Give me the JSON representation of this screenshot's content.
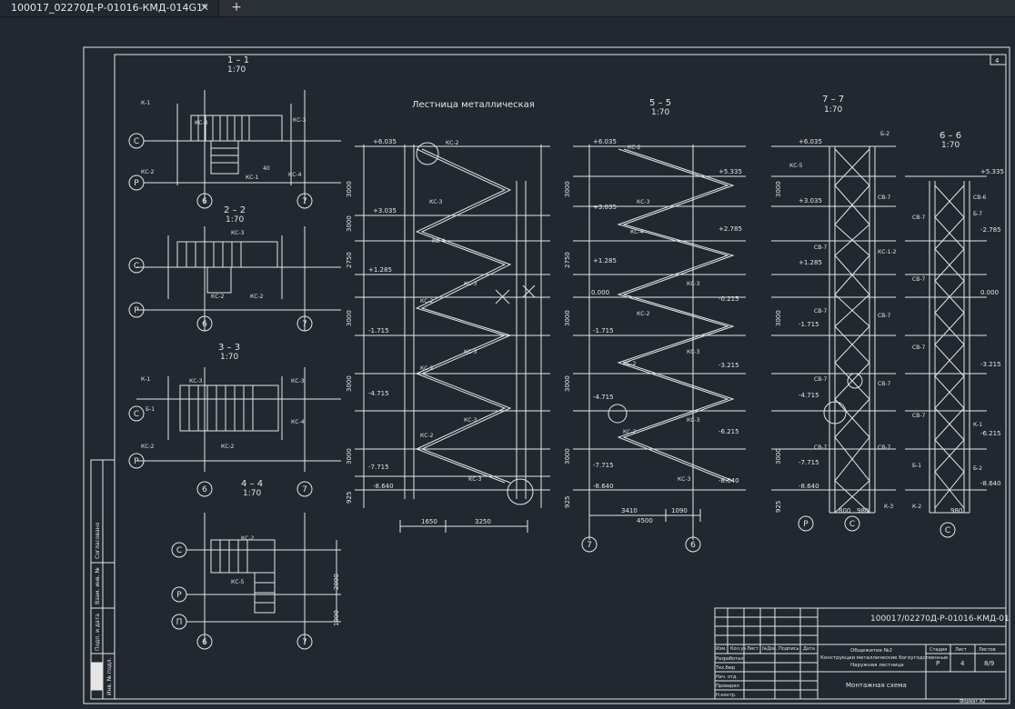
{
  "tabs": [
    {
      "label": "100017_02270Д-Р-01016-КМД-014G1*",
      "close_icon": "close-icon"
    }
  ],
  "new_tab_icon": "plus-icon",
  "drawing": {
    "stair_title": "Лестница металлическая",
    "sheet_corner_number": "4",
    "sections": [
      {
        "title": "1 – 1",
        "scale": "1:70"
      },
      {
        "title": "2 – 2",
        "scale": "1:70"
      },
      {
        "title": "3 – 3",
        "scale": "1:70"
      },
      {
        "title": "4 – 4",
        "scale": "1:70"
      },
      {
        "title": "5 – 5",
        "scale": "1:70"
      },
      {
        "title": "7 – 7",
        "scale": "1:70"
      },
      {
        "title": "6 – 6",
        "scale": "1:70"
      }
    ],
    "axis_letters": {
      "C": "С",
      "P": "Р",
      "Pi": "П",
      "six": "6",
      "seven": "7"
    },
    "elevations": [
      "+6.035",
      "+3.035",
      "+1.285",
      "0.000",
      "-1.715",
      "-4.715",
      "-7.715",
      "-8.640",
      "+5.335",
      "+2.785",
      "-0.215",
      "-3.215",
      "-6.215",
      "-2.785"
    ],
    "left_dims": [
      "3000",
      "3000",
      "2750",
      "3000",
      "3000",
      "3000",
      "925"
    ],
    "left_dims_lower": [
      "3000",
      "925"
    ],
    "plan_dims": {
      "width1": "1650",
      "width2": "3250",
      "width3": "3410",
      "width4": "1090",
      "total": "4500",
      "right1": "800",
      "right2": "980",
      "vert1": "2000",
      "vert2": "1000"
    },
    "marks": [
      "КС-1",
      "КС-2",
      "КС-3",
      "КС-4",
      "КС-5",
      "Б-1",
      "Б-2",
      "Б-7",
      "СВ-6",
      "СВ-7",
      "КС-1-2",
      "К-1",
      "К-2",
      "К-3",
      "40"
    ],
    "left_strip": [
      "Согласовано",
      "Взам. инв. №",
      "Подп. и дата",
      "Инв. № подл."
    ]
  },
  "title_block": {
    "doc_code": "100017/02270Д-Р-01016-КМД-01",
    "col_headers": [
      "Изм.",
      "Кол.уч",
      "Лист",
      "№Док.",
      "Подпись",
      "Дата"
    ],
    "roles": [
      "Разработал",
      "Тех.бюр",
      "Нач. отд.",
      "Проверил",
      "Н.контр."
    ],
    "project_name_1": "Общежитие №2",
    "project_name_2": "Конструкции металлические богоугодственные",
    "project_name_3": "Наружная лестница",
    "stage_header": "Стадия",
    "sheet_header": "Лист",
    "sheets_header": "Листов",
    "stage": "Р",
    "sheet": "4",
    "sheets": "8/9",
    "drawing_name": "Монтажная схема",
    "format": "Формат А2"
  },
  "colors": {
    "background": "#212830",
    "line": "#e6e6e6",
    "tab_bg": "#2b2f36"
  }
}
